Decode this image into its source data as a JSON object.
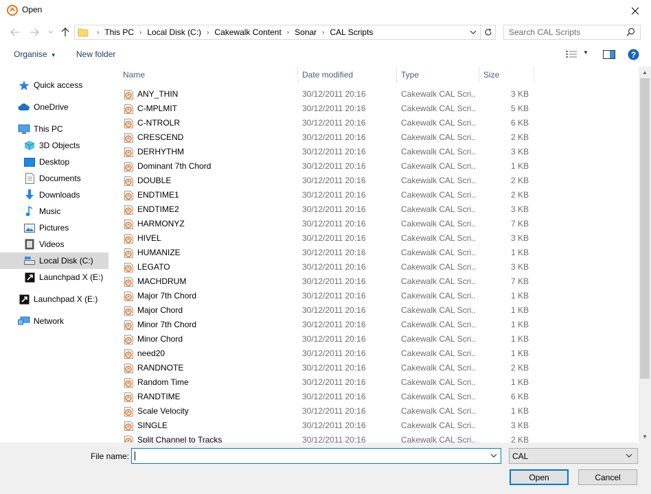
{
  "window": {
    "title": "Open"
  },
  "address": {
    "crumbs": [
      "This PC",
      "Local Disk (C:)",
      "Cakewalk Content",
      "Sonar",
      "CAL Scripts"
    ]
  },
  "search": {
    "placeholder": "Search CAL Scripts"
  },
  "toolbar": {
    "organise_label": "Organise",
    "new_folder_label": "New folder"
  },
  "sidebar": {
    "items": [
      {
        "label": "Quick access",
        "icon": "star-icon"
      },
      {
        "label": "OneDrive",
        "icon": "cloud-icon"
      },
      {
        "label": "This PC",
        "icon": "computer-icon"
      },
      {
        "label": "3D Objects",
        "icon": "cube-icon"
      },
      {
        "label": "Desktop",
        "icon": "desktop-icon"
      },
      {
        "label": "Documents",
        "icon": "document-icon"
      },
      {
        "label": "Downloads",
        "icon": "download-icon"
      },
      {
        "label": "Music",
        "icon": "music-icon"
      },
      {
        "label": "Pictures",
        "icon": "pictures-icon"
      },
      {
        "label": "Videos",
        "icon": "videos-icon"
      },
      {
        "label": "Local Disk (C:)",
        "icon": "drive-icon"
      },
      {
        "label": "Launchpad X (E:)",
        "icon": "launchpad-icon"
      },
      {
        "label": "Launchpad X (E:)",
        "icon": "launchpad-icon"
      },
      {
        "label": "Network",
        "icon": "network-icon"
      }
    ]
  },
  "columns": {
    "name": "Name",
    "date": "Date modified",
    "type": "Type",
    "size": "Size"
  },
  "files": [
    {
      "name": "ANY_THIN",
      "date": "30/12/2011 20:16",
      "type": "Cakewalk CAL Scri...",
      "size": "3 KB"
    },
    {
      "name": "C-MPLMIT",
      "date": "30/12/2011 20:16",
      "type": "Cakewalk CAL Scri...",
      "size": "5 KB"
    },
    {
      "name": "C-NTROLR",
      "date": "30/12/2011 20:16",
      "type": "Cakewalk CAL Scri...",
      "size": "6 KB"
    },
    {
      "name": "CRESCEND",
      "date": "30/12/2011 20:16",
      "type": "Cakewalk CAL Scri...",
      "size": "2 KB"
    },
    {
      "name": "DERHYTHM",
      "date": "30/12/2011 20:16",
      "type": "Cakewalk CAL Scri...",
      "size": "3 KB"
    },
    {
      "name": "Dominant 7th Chord",
      "date": "30/12/2011 20:16",
      "type": "Cakewalk CAL Scri...",
      "size": "1 KB"
    },
    {
      "name": "DOUBLE",
      "date": "30/12/2011 20:16",
      "type": "Cakewalk CAL Scri...",
      "size": "2 KB"
    },
    {
      "name": "ENDTIME1",
      "date": "30/12/2011 20:16",
      "type": "Cakewalk CAL Scri...",
      "size": "2 KB"
    },
    {
      "name": "ENDTIME2",
      "date": "30/12/2011 20:16",
      "type": "Cakewalk CAL Scri...",
      "size": "3 KB"
    },
    {
      "name": "HARMONYZ",
      "date": "30/12/2011 20:16",
      "type": "Cakewalk CAL Scri...",
      "size": "7 KB"
    },
    {
      "name": "HIVEL",
      "date": "30/12/2011 20:16",
      "type": "Cakewalk CAL Scri...",
      "size": "3 KB"
    },
    {
      "name": "HUMANIZE",
      "date": "30/12/2011 20:16",
      "type": "Cakewalk CAL Scri...",
      "size": "1 KB"
    },
    {
      "name": "LEGATO",
      "date": "30/12/2011 20:16",
      "type": "Cakewalk CAL Scri...",
      "size": "3 KB"
    },
    {
      "name": "MACHDRUM",
      "date": "30/12/2011 20:16",
      "type": "Cakewalk CAL Scri...",
      "size": "7 KB"
    },
    {
      "name": "Major 7th Chord",
      "date": "30/12/2011 20:16",
      "type": "Cakewalk CAL Scri...",
      "size": "1 KB"
    },
    {
      "name": "Major Chord",
      "date": "30/12/2011 20:16",
      "type": "Cakewalk CAL Scri...",
      "size": "1 KB"
    },
    {
      "name": "Minor 7th Chord",
      "date": "30/12/2011 20:16",
      "type": "Cakewalk CAL Scri...",
      "size": "1 KB"
    },
    {
      "name": "Minor Chord",
      "date": "30/12/2011 20:16",
      "type": "Cakewalk CAL Scri...",
      "size": "1 KB"
    },
    {
      "name": "need20",
      "date": "30/12/2011 20:16",
      "type": "Cakewalk CAL Scri...",
      "size": "1 KB"
    },
    {
      "name": "RANDNOTE",
      "date": "30/12/2011 20:16",
      "type": "Cakewalk CAL Scri...",
      "size": "2 KB"
    },
    {
      "name": "Random Time",
      "date": "30/12/2011 20:16",
      "type": "Cakewalk CAL Scri...",
      "size": "1 KB"
    },
    {
      "name": "RANDTIME",
      "date": "30/12/2011 20:16",
      "type": "Cakewalk CAL Scri...",
      "size": "6 KB"
    },
    {
      "name": "Scale Velocity",
      "date": "30/12/2011 20:16",
      "type": "Cakewalk CAL Scri...",
      "size": "1 KB"
    },
    {
      "name": "SINGLE",
      "date": "30/12/2011 20:16",
      "type": "Cakewalk CAL Scri...",
      "size": "3 KB"
    },
    {
      "name": "Split Channel to Tracks",
      "date": "30/12/2011 20:16",
      "type": "Cakewalk CAL Scri...",
      "size": "2 KB"
    }
  ],
  "footer": {
    "filename_label": "File name:",
    "filename_value": "",
    "filetype_value": "CAL",
    "open_label": "Open",
    "cancel_label": "Cancel"
  },
  "colors": {
    "accent": "#0078d7",
    "file_icon": "#e8731d",
    "selected_bg": "#d9d9d9"
  }
}
